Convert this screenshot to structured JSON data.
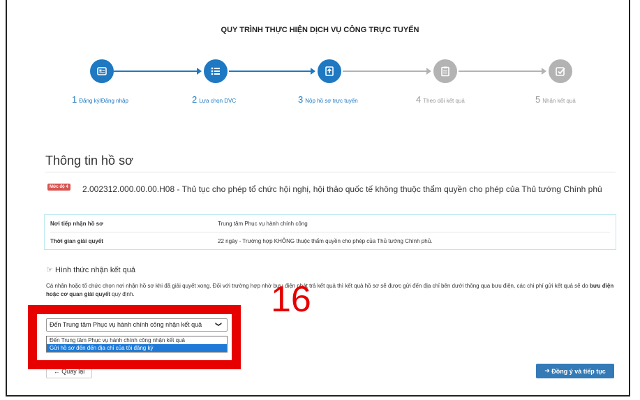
{
  "page_title": "QUY TRÌNH THỰC HIỆN DỊCH VỤ CÔNG TRỰC TUYẾN",
  "steps": [
    {
      "num": "1",
      "label": "Đăng ký/Đăng nhập",
      "state": "done",
      "icon": "id-card-icon"
    },
    {
      "num": "2",
      "label": "Lựa chọn DVC",
      "state": "done",
      "icon": "list-icon"
    },
    {
      "num": "3",
      "label": "Nộp hồ sơ trực tuyến",
      "state": "active",
      "icon": "upload-document-icon"
    },
    {
      "num": "4",
      "label": "Theo dõi kết quả",
      "state": "pending",
      "icon": "clipboard-icon"
    },
    {
      "num": "5",
      "label": "Nhận kết quả",
      "state": "pending",
      "icon": "check-square-icon"
    }
  ],
  "colors": {
    "active": "#1e78c2",
    "inactive": "#b3b3b3",
    "accent_red": "#e60000",
    "primary_button": "#337ab7"
  },
  "section_title": "Thông tin hồ sơ",
  "level_badge": "Mức độ 4",
  "procedure_name": "2.002312.000.00.00.H08 - Thủ tục cho phép tổ chức hội nghị, hội thảo quốc tế không thuộc thẩm quyền cho phép của Thủ tướng Chính phủ",
  "info": [
    {
      "key": "Nơi tiếp nhận hồ sơ",
      "value": "Trung tâm Phục vụ hành chính công"
    },
    {
      "key": "Thời gian giải quyết",
      "value": "22 ngày - Trường hợp KHÔNG thuộc thẩm quyền cho phép của Thủ tướng Chính phủ."
    }
  ],
  "receive": {
    "title": "Hình thức nhận kết quả",
    "desc_part1": "Cá nhân hoặc tổ chức chọn nơi nhận hồ sơ khi đã giải quyết xong. Đối với trường hợp nhờ bưu điện phát trả kết quả thì kết quả hồ sơ sẽ được gửi đến địa chỉ bên dưới thông qua bưu điện, các chi phí gửi kết quả sẽ do ",
    "desc_bold1": "bưu điện hoặc cơ quan giải quyết",
    "desc_part2": " quy định.",
    "field_label": "Hình thức nhận kết quả *",
    "selected_value": "Đến Trung tâm Phục vụ hành chính công nhận kết quả",
    "options": [
      "Đến Trung tâm Phục vụ hành chính công nhận kết quả",
      "Gửi hồ sơ đến đến địa chỉ của tôi đăng ký"
    ]
  },
  "buttons": {
    "back": "Quay lại",
    "next": "Đồng ý và tiếp tục"
  },
  "annotation_number": "16"
}
